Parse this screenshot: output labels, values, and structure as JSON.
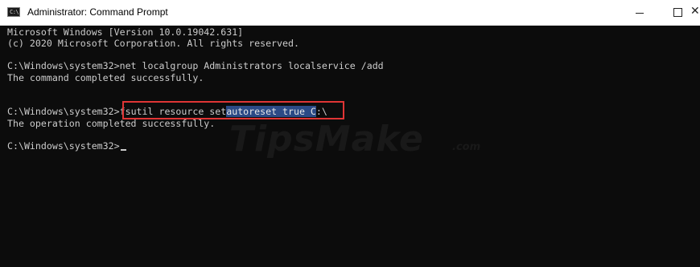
{
  "window": {
    "title": "Administrator: Command Prompt",
    "app_icon_glyph": "C:\\",
    "controls": {
      "minimize_icon": "minimize-icon",
      "maximize_icon": "maximize-icon",
      "close_icon": "close-icon",
      "close_glyph": "✕"
    }
  },
  "console": {
    "lines": [
      "Microsoft Windows [Version 10.0.19042.631]",
      "(c) 2020 Microsoft Corporation. All rights reserved.",
      "",
      "C:\\Windows\\system32>net localgroup Administrators localservice /add",
      "The command completed successfully.",
      "",
      "",
      "",
      "The operation completed successfully.",
      "",
      "C:\\Windows\\system32>"
    ],
    "highlight_line": {
      "prompt": "C:\\Windows\\system32>",
      "before_selection": "fsutil resource set",
      "selection": "autoreset true C",
      "after_selection": ":\\"
    }
  },
  "watermark": {
    "text": "TipsMake",
    "suffix": ".com"
  },
  "colors": {
    "console_bg": "#0c0c0c",
    "console_text": "#cccccc",
    "selection_bg": "#2b4a86",
    "highlight_border": "#e03535",
    "titlebar_bg": "#ffffff"
  }
}
